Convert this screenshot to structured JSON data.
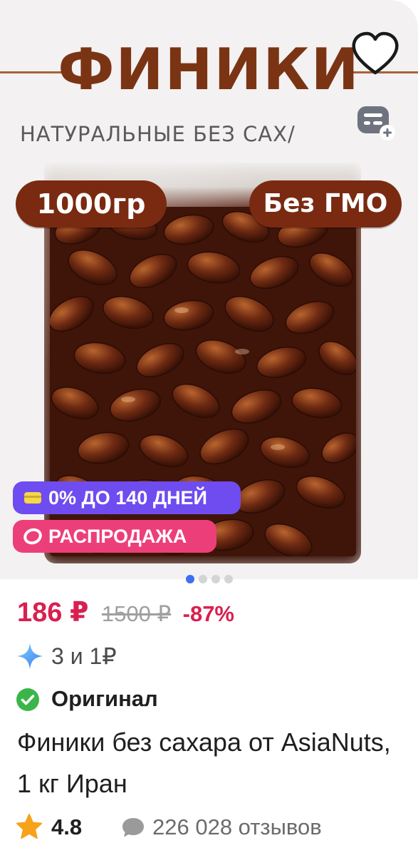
{
  "product_image": {
    "banner_title": "ФИНИКИ",
    "banner_subtitle": "НАТУРАЛЬНЫЕ БЕЗ САХ/",
    "weight_label": "1000гр",
    "gmo_label": "Без ГМО",
    "image_count": 4,
    "active_image": 1
  },
  "badges": {
    "installment": "0% ДО 140 ДНЕЙ",
    "sale": "РАСПРОДАЖА"
  },
  "price": {
    "current": "186 ₽",
    "old": "1500 ₽",
    "discount": "-87%"
  },
  "bonus": {
    "text": "3 и 1₽"
  },
  "original": {
    "label": "Оригинал"
  },
  "title": "Финики без сахара от AsiaNuts, 1 кг Иран",
  "rating": {
    "value": "4.8",
    "reviews": "226 028 отзывов"
  },
  "colors": {
    "accent_price": "#d8204f",
    "installment_badge": "#6f4cef",
    "sale_badge": "#ec3f7a",
    "banner_brown": "#7a3414",
    "pill_brown": "#7a2a11",
    "check_green": "#3bb54a",
    "star_orange": "#f7a21b",
    "active_dot": "#3d6ff0"
  },
  "icons": {
    "favorite": "heart-icon",
    "compare": "list-add-icon",
    "installment": "card-icon",
    "sale": "ring-icon",
    "bonus": "sparkle-icon",
    "original": "check-circle-icon",
    "rating": "star-icon",
    "reviews": "speech-bubble-icon"
  }
}
